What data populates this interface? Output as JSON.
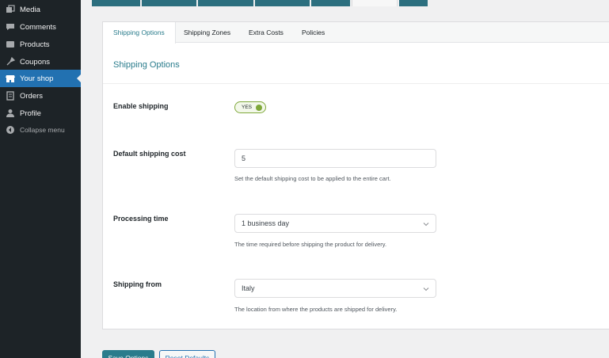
{
  "sidebar": {
    "items": [
      {
        "name": "media",
        "label": "Media",
        "icon": "media-icon"
      },
      {
        "name": "comments",
        "label": "Comments",
        "icon": "comment-icon"
      },
      {
        "name": "products",
        "label": "Products",
        "icon": "products-icon"
      },
      {
        "name": "coupons",
        "label": "Coupons",
        "icon": "coupon-icon"
      },
      {
        "name": "your-shop",
        "label": "Your shop",
        "icon": "store-icon",
        "active": true
      },
      {
        "name": "orders",
        "label": "Orders",
        "icon": "orders-icon"
      },
      {
        "name": "profile",
        "label": "Profile",
        "icon": "user-icon"
      }
    ],
    "collapse_label": "Collapse menu"
  },
  "subtabs": [
    "Shipping Options",
    "Shipping Zones",
    "Extra Costs",
    "Policies"
  ],
  "section": {
    "title": "Shipping Options"
  },
  "fields": {
    "enable_shipping": {
      "label": "Enable shipping",
      "toggle_text": "YES",
      "enabled": true
    },
    "default_cost": {
      "label": "Default shipping cost",
      "value": "5",
      "hint": "Set the default shipping cost to be applied to the entire cart."
    },
    "processing_time": {
      "label": "Processing time",
      "value": "1 business day",
      "hint": "The time required before shipping the product for delivery."
    },
    "shipping_from": {
      "label": "Shipping from",
      "value": "Italy",
      "hint": "The location from where the products are shipped for delivery."
    }
  },
  "buttons": {
    "save": "Save Options",
    "reset": "Reset Defaults"
  },
  "colors": {
    "accent": "#2a7c8c",
    "sidebar_bg": "#1d2327",
    "active_menu": "#2271b1",
    "toggle_on": "#7fa83a"
  }
}
